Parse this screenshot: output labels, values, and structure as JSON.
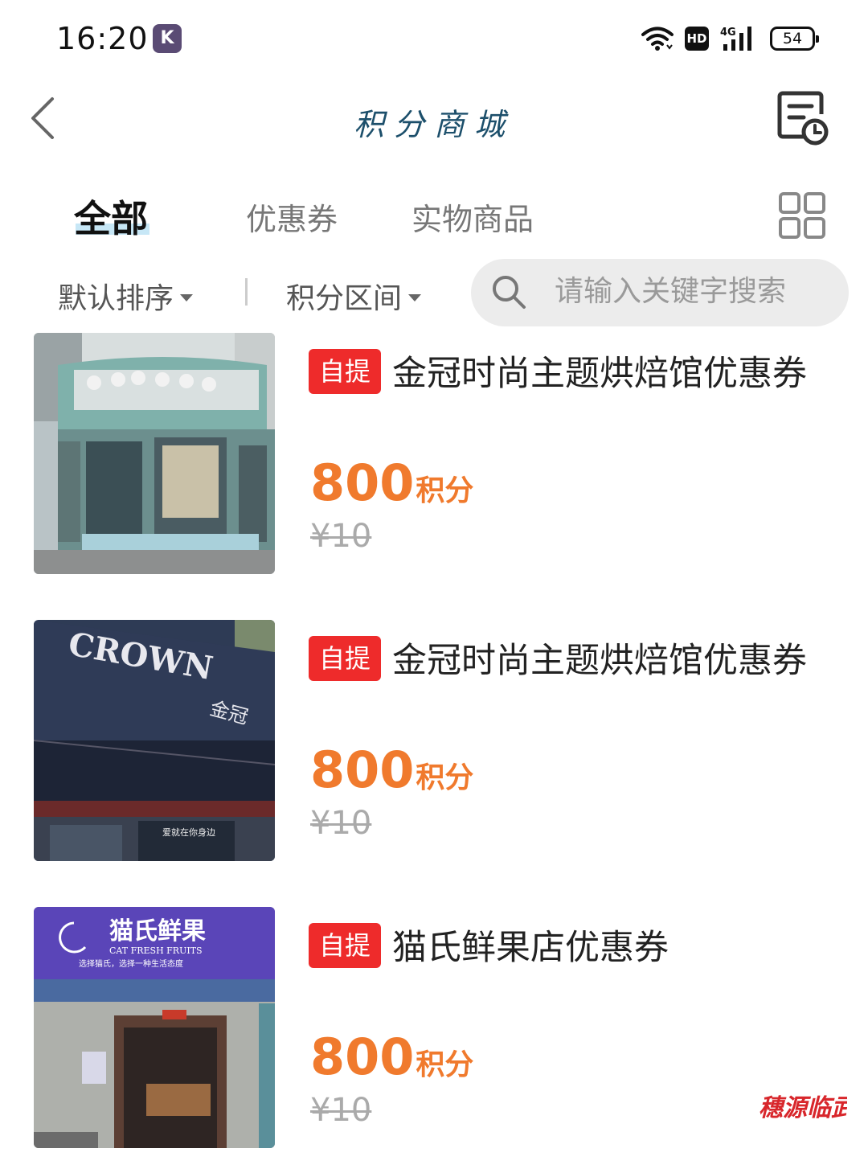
{
  "status_bar": {
    "time": "16:20",
    "app_badge": "K",
    "hd": "HD",
    "network": "4G",
    "battery": "54"
  },
  "header": {
    "title": "积分商城"
  },
  "tabs": [
    {
      "label": "全部",
      "active": true
    },
    {
      "label": "优惠券",
      "active": false
    },
    {
      "label": "实物商品",
      "active": false
    }
  ],
  "filters": {
    "sort_label": "默认排序",
    "range_label": "积分区间",
    "search_placeholder": "请输入关键字搜索"
  },
  "products": [
    {
      "tag": "自提",
      "title": "金冠时尚主题烘焙馆优惠券",
      "points": "800",
      "points_unit": "积分",
      "original_price": "¥10"
    },
    {
      "tag": "自提",
      "title": "金冠时尚主题烘焙馆优惠券",
      "points": "800",
      "points_unit": "积分",
      "original_price": "¥10"
    },
    {
      "tag": "自提",
      "title": "猫氏鲜果店优惠券",
      "points": "800",
      "points_unit": "积分",
      "original_price": "¥10"
    }
  ],
  "store_signs": {
    "crown": "CROWN",
    "crown_cn": "金冠",
    "crown_slogan": "爱就在你身边",
    "cat_cn": "猫氏鲜果",
    "cat_en": "CAT FRESH FRUITS",
    "cat_slogan": "选择猫氏，选择一种生活态度"
  },
  "watermark": {
    "text": "穗源临武"
  },
  "colors": {
    "accent_orange": "#f07a2d",
    "tag_red": "#ee2b2b",
    "title_blue": "#1c4f6b",
    "tab_underline": "#bde3f5"
  },
  "icons": [
    "back-arrow-icon",
    "records-icon",
    "grid-view-icon",
    "search-icon",
    "wifi-icon",
    "signal-icon"
  ]
}
